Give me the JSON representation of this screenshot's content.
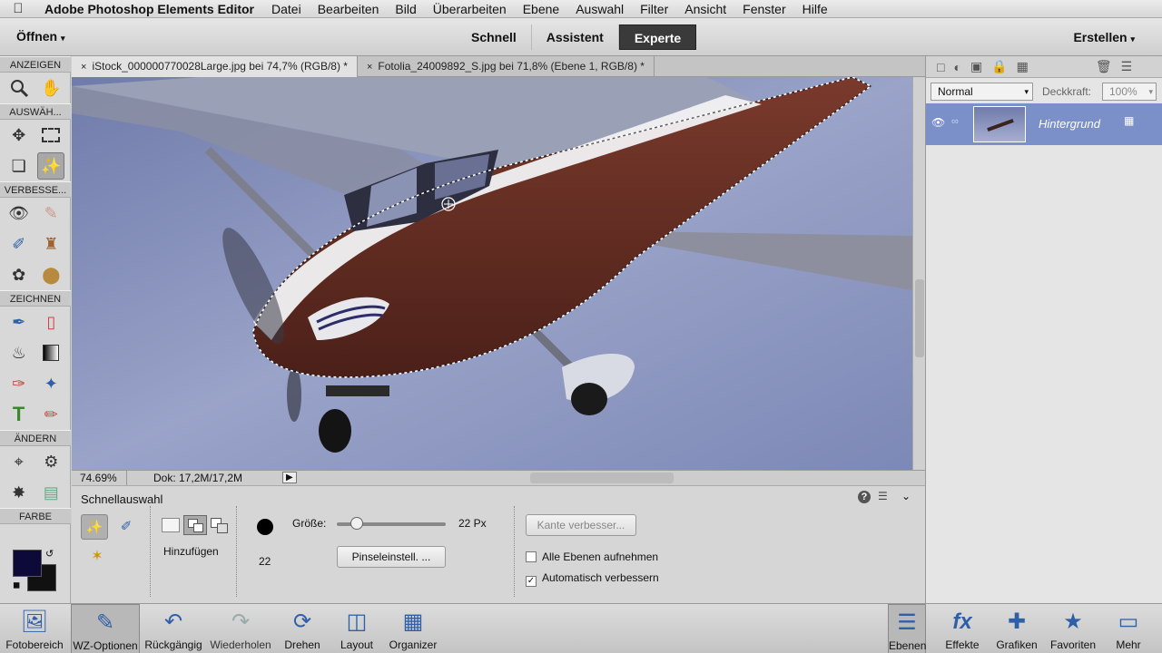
{
  "menubar": {
    "app_name": "Adobe Photoshop Elements Editor",
    "items": [
      "Datei",
      "Bearbeiten",
      "Bild",
      "Überarbeiten",
      "Ebene",
      "Auswahl",
      "Filter",
      "Ansicht",
      "Fenster",
      "Hilfe"
    ]
  },
  "modebar": {
    "open_label": "Öffnen",
    "create_label": "Erstellen",
    "modes": [
      "Schnell",
      "Assistent",
      "Experte"
    ],
    "active_mode": "Experte"
  },
  "toolbox": {
    "sections": [
      "ANZEIGEN",
      "AUSWÄH...",
      "VERBESSE...",
      "ZEICHNEN",
      "ÄNDERN",
      "FARBE"
    ],
    "colors": {
      "foreground": "#0d0a3a",
      "background": "#111111"
    }
  },
  "tabs": [
    {
      "label": "iStock_000000770028Large.jpg bei 74,7% (RGB/8) *",
      "active": true
    },
    {
      "label": "Fotolia_24009892_S.jpg bei 71,8% (Ebene 1, RGB/8) *",
      "active": false
    }
  ],
  "status": {
    "zoom": "74.69%",
    "doc": "Dok: 17,2M/17,2M"
  },
  "options": {
    "tool_name": "Schnellauswahl",
    "mode_label": "Hinzufügen",
    "size_label": "Größe:",
    "size_value": "22 Px",
    "brush_size": "22",
    "brush_settings_button": "Pinseleinstell. ...",
    "refine_edge_button": "Kante verbesser...",
    "all_layers_label": "Alle Ebenen aufnehmen",
    "all_layers_checked": false,
    "auto_enhance_label": "Automatisch verbessern",
    "auto_enhance_checked": true,
    "size_slider_fraction": 0.18
  },
  "layers": {
    "blend_mode": "Normal",
    "opacity_label": "Deckkraft:",
    "opacity_value": "100%",
    "items": [
      {
        "name": "Hintergrund"
      }
    ]
  },
  "bottombar": {
    "items": [
      "Fotobereich",
      "WZ-Optionen",
      "Rückgängig",
      "Wiederholen",
      "Drehen",
      "Layout",
      "Organizer"
    ],
    "right_items": [
      "Ebenen",
      "Effekte",
      "Grafiken",
      "Favoriten",
      "Mehr"
    ]
  }
}
